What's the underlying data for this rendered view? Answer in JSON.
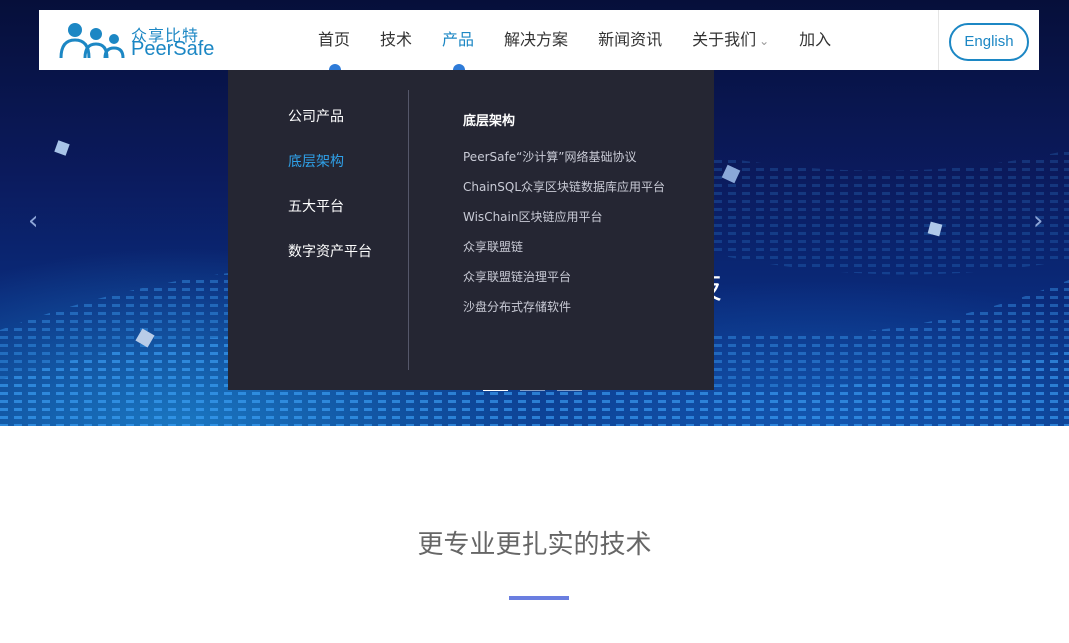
{
  "header": {
    "logo_cn": "众享比特",
    "logo_en": "PeerSafe",
    "nav": [
      {
        "label": "首页",
        "active": false
      },
      {
        "label": "技术",
        "active": false
      },
      {
        "label": "产品",
        "active": true
      },
      {
        "label": "解决方案",
        "active": false
      },
      {
        "label": "新闻资讯",
        "active": false
      },
      {
        "label": "关于我们",
        "active": false,
        "has_dropdown": true
      },
      {
        "label": "加入",
        "active": false
      }
    ],
    "chevron_icon": "chevron-down-icon",
    "language_button": "English"
  },
  "dropdown": {
    "categories": [
      {
        "label": "公司产品",
        "active": false
      },
      {
        "label": "底层架构",
        "active": true
      },
      {
        "label": "五大平台",
        "active": false
      },
      {
        "label": "数字资产平台",
        "active": false
      }
    ],
    "panel_title": "底层架构",
    "links": [
      "PeerSafe“沙计算”网络基础协议",
      "ChainSQL众享区块链数据库应用平台",
      "WisChain区块链应用平台",
      "众享联盟链",
      "众享联盟链治理平台",
      "沙盘分布式存储软件"
    ]
  },
  "hero": {
    "visible_text": "技",
    "prev_icon": "chevron-left-icon",
    "next_icon": "chevron-right-icon",
    "slide_count": 3,
    "active_slide": 1
  },
  "section": {
    "title": "更专业更扎实的技术"
  },
  "colors": {
    "brand": "#1c87c4",
    "dropdown_bg": "#252633",
    "dropdown_active": "#2fa0e8",
    "accent_bar": "#6a7ee0"
  }
}
